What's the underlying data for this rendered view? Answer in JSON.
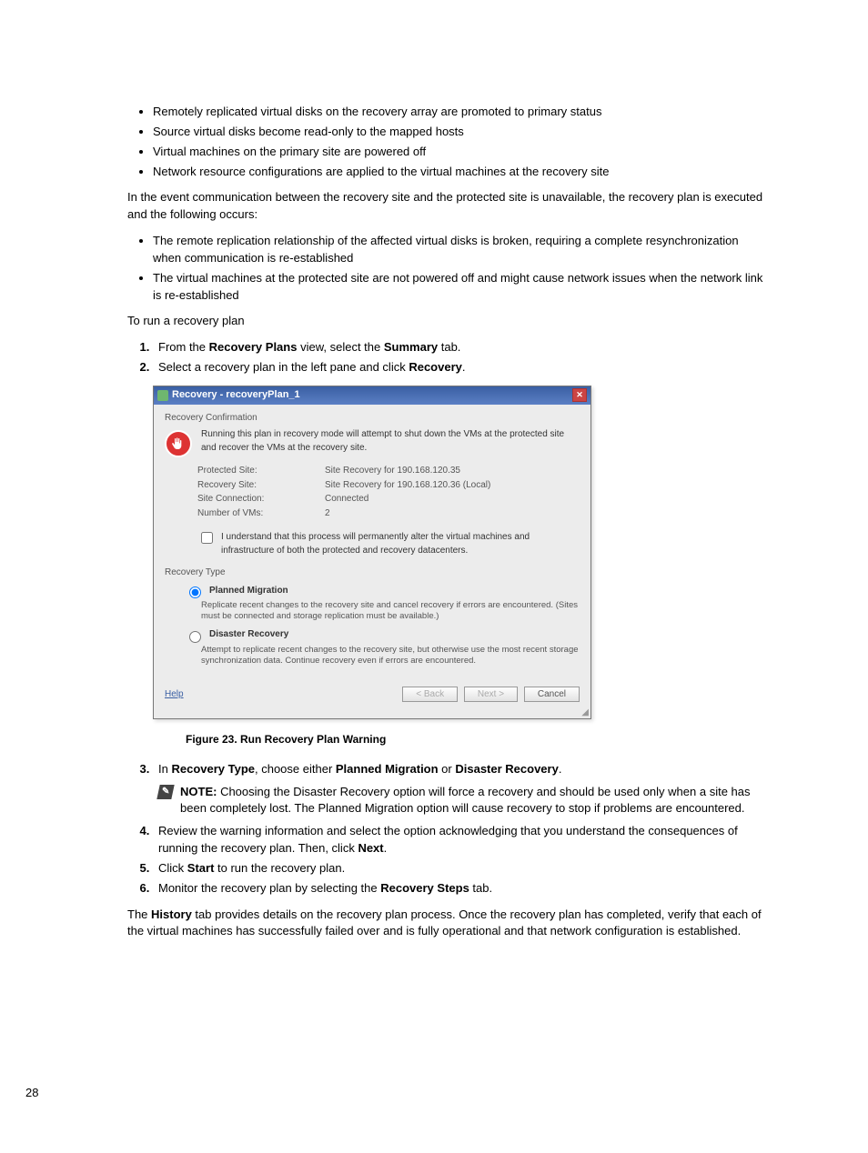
{
  "bullets_top": [
    "Remotely replicated virtual disks on the recovery array are promoted to primary status",
    "Source virtual disks become read-only to the mapped hosts",
    "Virtual machines on the primary site are powered off",
    "Network resource configurations are applied to the virtual machines at the recovery site"
  ],
  "para_event": "In the event communication between the recovery site and the protected site is unavailable, the recovery plan is executed and the following occurs:",
  "bullets_event": [
    "The remote replication relationship of the affected virtual disks is broken, requiring a complete resynchronization when communication is re-established",
    "The virtual machines at the protected site are not powered off and might cause network issues when the network link is re-established"
  ],
  "para_run": "To run a recovery plan",
  "step1": {
    "pre": "From the ",
    "b1": "Recovery Plans",
    "mid": " view, select the ",
    "b2": "Summary",
    "post": " tab."
  },
  "step2": {
    "pre": "Select a recovery plan in the left pane and click ",
    "b1": "Recovery",
    "post": "."
  },
  "dialog": {
    "title": "Recovery - recoveryPlan_1",
    "confirm_label": "Recovery Confirmation",
    "confirm_text": "Running this plan in recovery mode will attempt to shut down the VMs at the protected site and recover the VMs at the recovery site.",
    "info": {
      "protected_site_label": "Protected Site:",
      "protected_site_value": "Site Recovery for 190.168.120.35",
      "recovery_site_label": "Recovery Site:",
      "recovery_site_value": "Site Recovery for 190.168.120.36 (Local)",
      "connection_label": "Site Connection:",
      "connection_value": "Connected",
      "vms_label": "Number of VMs:",
      "vms_value": "2"
    },
    "ack": "I understand that this process will permanently alter the virtual machines and infrastructure of both the protected and recovery datacenters.",
    "recovery_type_label": "Recovery Type",
    "planned": {
      "title": "Planned Migration",
      "desc": "Replicate recent changes to the recovery site and cancel recovery if errors are encountered. (Sites must be connected and storage replication must be available.)"
    },
    "disaster": {
      "title": "Disaster Recovery",
      "desc": "Attempt to replicate recent changes to the recovery site, but otherwise use the most recent storage synchronization data. Continue recovery even if errors are encountered."
    },
    "help": "Help",
    "back": "< Back",
    "next": "Next >",
    "cancel": "Cancel"
  },
  "figure_caption": "Figure 23. Run Recovery Plan Warning",
  "step3": {
    "pre": "In ",
    "b1": "Recovery Type",
    "mid": ", choose either ",
    "b2": "Planned Migration",
    "mid2": " or ",
    "b3": "Disaster Recovery",
    "post": "."
  },
  "note": {
    "label": "NOTE: ",
    "text": "Choosing the Disaster Recovery option will force a recovery and should be used only when a site has been completely lost. The Planned Migration option will cause recovery to stop if problems are encountered."
  },
  "step4": {
    "pre": "Review the warning information and select the option acknowledging that you understand the consequences of running the recovery plan. Then, click ",
    "b1": "Next",
    "post": "."
  },
  "step5": {
    "pre": "Click ",
    "b1": "Start",
    "post": " to run the recovery plan."
  },
  "step6": {
    "pre": "Monitor the recovery plan by selecting the ",
    "b1": "Recovery Steps",
    "post": " tab."
  },
  "para_history": {
    "pre": "The ",
    "b1": "History",
    "post": " tab provides details on the recovery plan process. Once the recovery plan has completed, verify that each of the virtual machines has successfully failed over and is fully operational and that network configuration is established."
  },
  "page_number": "28"
}
